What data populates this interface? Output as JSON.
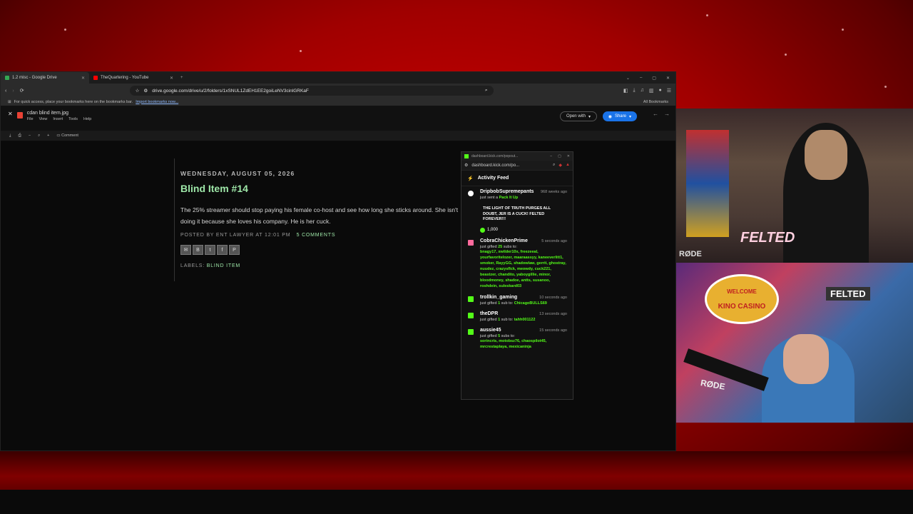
{
  "browser": {
    "tabs": [
      {
        "label": "1.2 misc - Google Drive",
        "active": true,
        "favicon_color": "#34a853"
      },
      {
        "label": "TheQuartering - YouTube",
        "active": false,
        "favicon_color": "#ff0000"
      }
    ],
    "url": "drive.google.com/drive/u/2/folders/1xSNUL1ZdEH1EE2goiLeNV3cinlGRKaF",
    "bookmarks_hint": "For quick access, place your bookmarks here on the bookmarks bar.",
    "bookmarks_import": "Import bookmarks now...",
    "all_bookmarks": "All Bookmarks"
  },
  "drive": {
    "file_name": "cdan blind item.jpg",
    "menus": [
      "File",
      "View",
      "Insert",
      "Tools",
      "Help"
    ],
    "open_with": "Open with",
    "share": "Share",
    "comment": "Comment"
  },
  "post": {
    "date": "WEDNESDAY, AUGUST 05, 2026",
    "title": "Blind Item #14",
    "body": "The 25% streamer should stop paying his female co-host and see how long she sticks around. She isn't doing it because she loves his company. He is her cuck.",
    "posted_by": "POSTED BY ENT LAWYER AT 12:01 PM",
    "comments": "5 COMMENTS",
    "labels_prefix": "LABELS:",
    "label": "BLIND ITEM"
  },
  "kick": {
    "window_title": "dashboard.kick.com/popout...",
    "url": "dashboard.kick.com/po...",
    "feed_title": "Activity Feed",
    "items": [
      {
        "user": "DripbobSupremepants",
        "time": "968 weeks ago",
        "action": "just sent a",
        "highlight": "Pack It Up",
        "message": "THE LIGHT OF TRUTH PURGES ALL DOUBT, JER IS A CUCK! FELTED FOREVER!!!",
        "amount": "1,000",
        "icon_color": "#ffffff"
      },
      {
        "user": "CobraChickenPrime",
        "time": "5 seconds ago",
        "action": "just gifted",
        "count": "25",
        "action2": "subs to:",
        "names": "bnagy17, xwilder10x, freezeeal, yourfavoritelozer, maaraassyy, kaneeverlitt1, smoker, RayyGG, shadowlaw, gerrit, ghostray, nuudez, crazysflck, meowdy, cuck221, beastzer, chandito, yaboygillie, minor, bloodmoney, shadoe, antts, susanoo, roshdein, suleskard03",
        "icon_color": "#ff6b9d"
      },
      {
        "user": "trollkin_gaming",
        "time": "10 seconds ago",
        "action": "just gifted",
        "count": "1",
        "action2": "sub to:",
        "names": "ChicagoBULLS69",
        "icon_color": "#53fc18"
      },
      {
        "user": "theDPR",
        "time": "13 seconds ago",
        "action": "just gifted",
        "count": "1",
        "action2": "sub to:",
        "names": "tahh001122",
        "icon_color": "#53fc18"
      },
      {
        "user": "aussie45",
        "time": "15 seconds ago",
        "action": "just gifted",
        "count": "5",
        "action2": "subs to:",
        "names": "sorincris, motobsz76, chaospilot45, mrcrestaplaya, mexicaninja",
        "icon_color": "#53fc18"
      }
    ]
  },
  "cams": {
    "top_sign": "FELTED",
    "bottom_welcome": "WELCOME",
    "bottom_sign": "KINO CASINO",
    "bottom_felted": "FELTED",
    "mic_brand": "RØDE"
  },
  "colors": {
    "accent_green": "#53fc18",
    "bg_red": "#c00000"
  }
}
